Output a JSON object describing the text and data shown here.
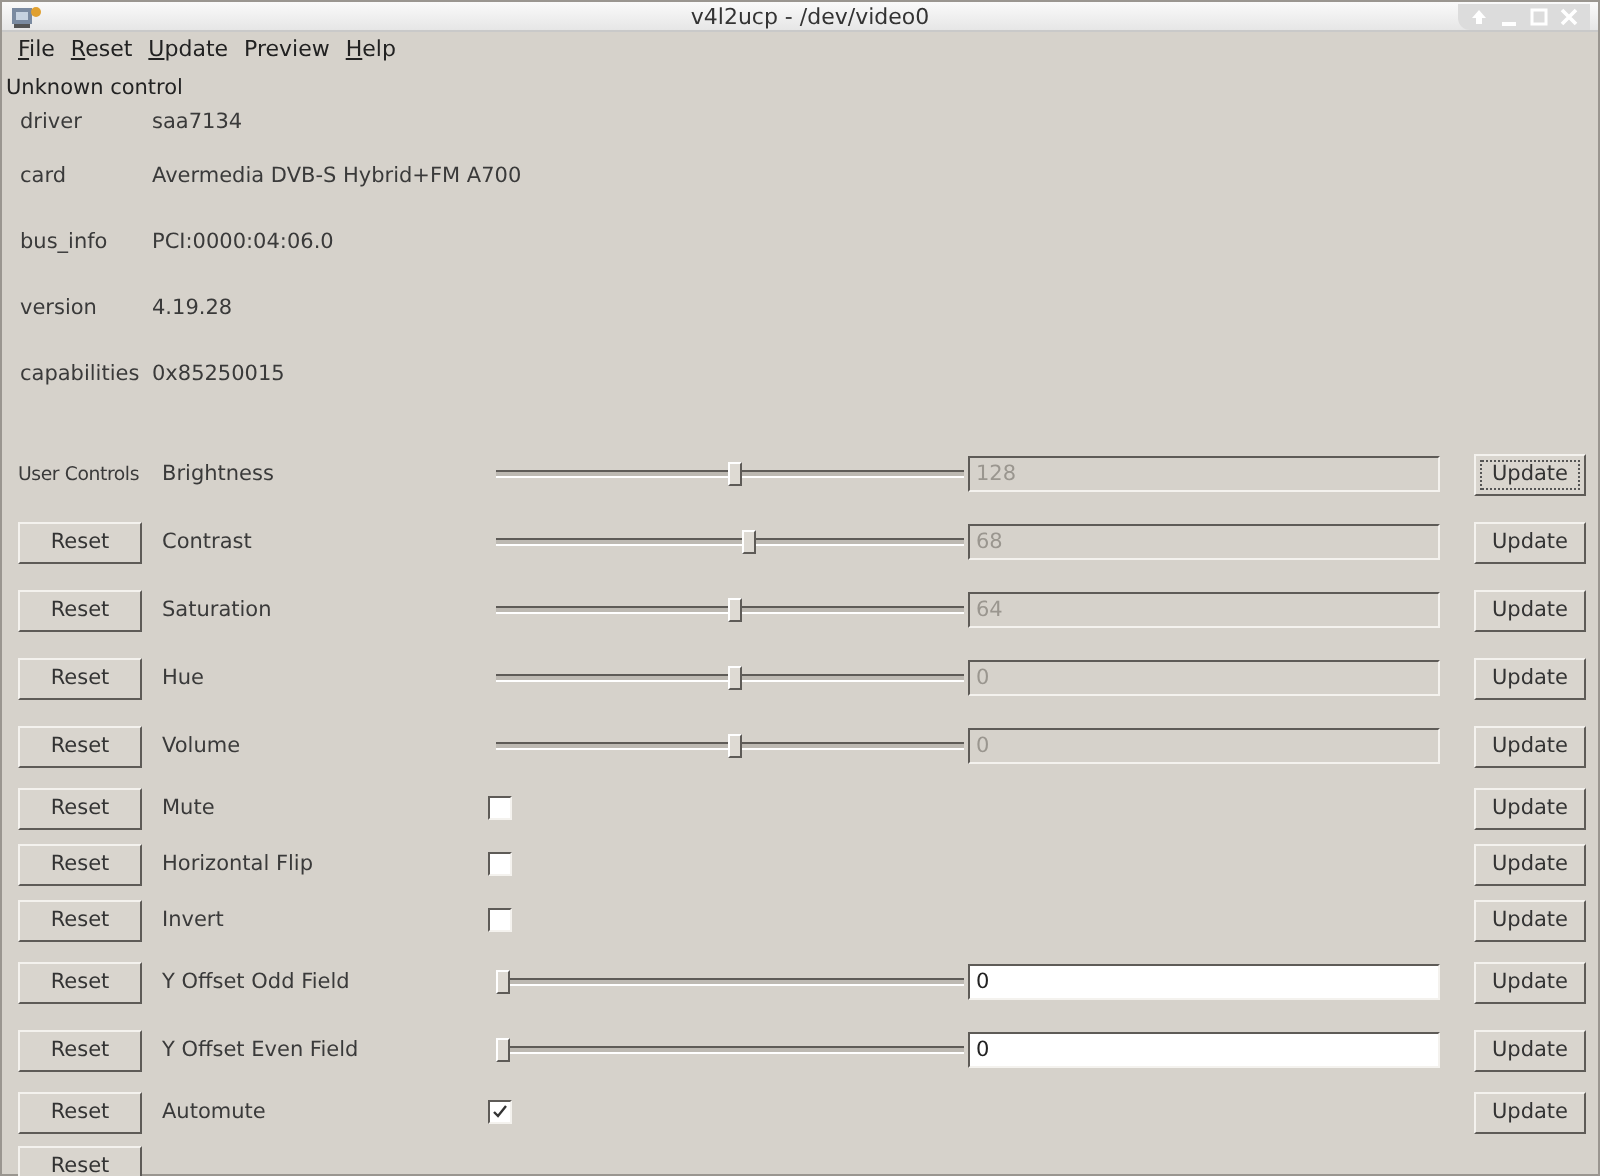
{
  "window": {
    "title": "v4l2ucp - /dev/video0"
  },
  "menu": [
    {
      "underlined": "F",
      "text": "ile"
    },
    {
      "underlined": "R",
      "text": "eset"
    },
    {
      "underlined": "U",
      "text": "pdate"
    },
    {
      "text": "Preview"
    },
    {
      "underlined": "H",
      "text": "elp"
    }
  ],
  "notice": "Unknown control",
  "info": [
    {
      "key": "driver",
      "value": "saa7134"
    },
    {
      "key": "card",
      "value": "Avermedia DVB-S Hybrid+FM A700"
    },
    {
      "key": "bus_info",
      "value": "PCI:0000:04:06.0"
    },
    {
      "key": "version",
      "value": "4.19.28"
    },
    {
      "key": "capabilities",
      "value": "0x85250015"
    }
  ],
  "controls": [
    {
      "kind": "slider",
      "section": "User Controls",
      "label": "Brightness",
      "level": 0.51,
      "value": "128",
      "disabled": true,
      "update": "Update"
    },
    {
      "kind": "slider",
      "reset": "Reset",
      "label": "Contrast",
      "level": 0.54,
      "value": "68",
      "disabled": true,
      "update": "Update"
    },
    {
      "kind": "slider",
      "reset": "Reset",
      "label": "Saturation",
      "level": 0.51,
      "value": "64",
      "disabled": true,
      "update": "Update"
    },
    {
      "kind": "slider",
      "reset": "Reset",
      "label": "Hue",
      "level": 0.51,
      "value": "0",
      "disabled": true,
      "update": "Update"
    },
    {
      "kind": "slider",
      "reset": "Reset",
      "label": "Volume",
      "level": 0.51,
      "value": "0",
      "disabled": true,
      "update": "Update"
    },
    {
      "kind": "checkbox",
      "reset": "Reset",
      "label": "Mute",
      "checked": false,
      "update": "Update"
    },
    {
      "kind": "checkbox",
      "reset": "Reset",
      "label": "Horizontal Flip",
      "checked": false,
      "update": "Update"
    },
    {
      "kind": "checkbox",
      "reset": "Reset",
      "label": "Invert",
      "checked": false,
      "update": "Update"
    },
    {
      "kind": "slider",
      "reset": "Reset",
      "label": "Y Offset Odd Field",
      "level": 0,
      "value": "0",
      "disabled": false,
      "update": "Update"
    },
    {
      "kind": "slider",
      "reset": "Reset",
      "label": "Y Offset Even Field",
      "level": 0,
      "value": "0",
      "disabled": false,
      "update": "Update"
    },
    {
      "kind": "checkbox",
      "reset": "Reset",
      "label": "Automute",
      "checked": true,
      "update": "Update"
    },
    {
      "kind": "button",
      "reset": "Reset"
    }
  ]
}
